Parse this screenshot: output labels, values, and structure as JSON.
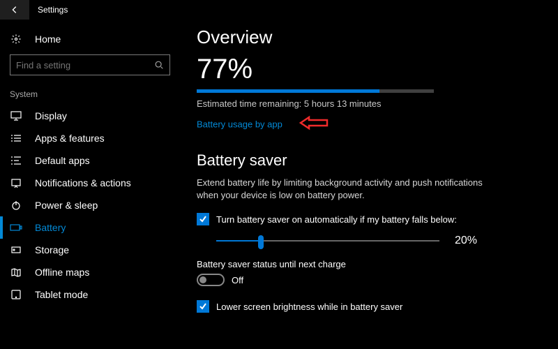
{
  "titlebar": {
    "title": "Settings"
  },
  "sidebar": {
    "home_label": "Home",
    "search_placeholder": "Find a setting",
    "section_label": "System",
    "items": [
      {
        "label": "Display"
      },
      {
        "label": "Apps & features"
      },
      {
        "label": "Default apps"
      },
      {
        "label": "Notifications & actions"
      },
      {
        "label": "Power & sleep"
      },
      {
        "label": "Battery"
      },
      {
        "label": "Storage"
      },
      {
        "label": "Offline maps"
      },
      {
        "label": "Tablet mode"
      }
    ],
    "selected_index": 5
  },
  "content": {
    "heading": "Overview",
    "battery_pct_text": "77%",
    "battery_pct_value": 77,
    "estimated_remaining": "Estimated time remaining: 5 hours 13 minutes",
    "usage_link": "Battery usage by app",
    "saver_heading": "Battery saver",
    "saver_desc": "Extend battery life by limiting background activity and push notifications when your device is low on battery power.",
    "auto_on_label": "Turn battery saver on automatically if my battery falls below:",
    "auto_on_checked": true,
    "slider_value": 20,
    "slider_value_text": "20%",
    "status_label": "Battery saver status until next charge",
    "status_toggle_on": false,
    "status_toggle_text": "Off",
    "lower_brightness_label": "Lower screen brightness while in battery saver",
    "lower_brightness_checked": true
  },
  "annotation": {
    "arrow_color": "#ef2b2b"
  }
}
